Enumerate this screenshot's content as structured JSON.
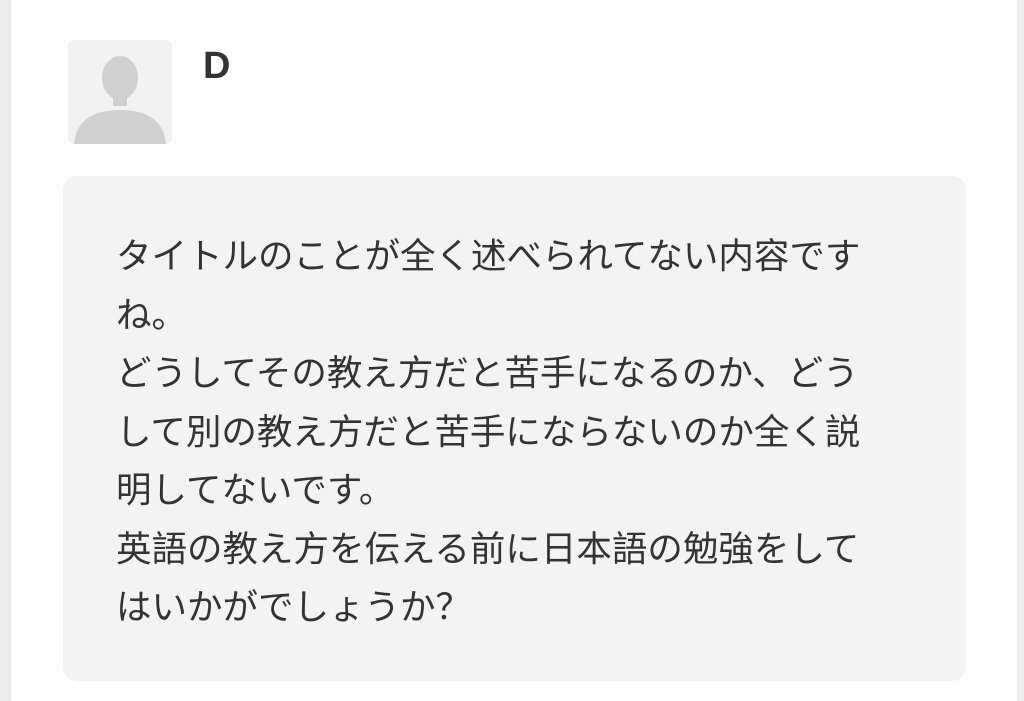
{
  "comment": {
    "author": {
      "name": "D",
      "avatar_icon": "default-user-silhouette-icon"
    },
    "body": "タイトルのことが全く述べられてない内容ですね。\nどうしてその教え方だと苦手になるのか、どうして別の教え方だと苦手にならないのか全く説明してないです。\n英語の教え方を伝える前に日本語の勉強をしてはいかがでしょうか？"
  },
  "colors": {
    "background": "#ffffff",
    "comment_box": "#f3f3f3",
    "text": "#333333",
    "avatar_bg": "#f2f2f2",
    "avatar_silhouette": "#cfcfcf"
  }
}
